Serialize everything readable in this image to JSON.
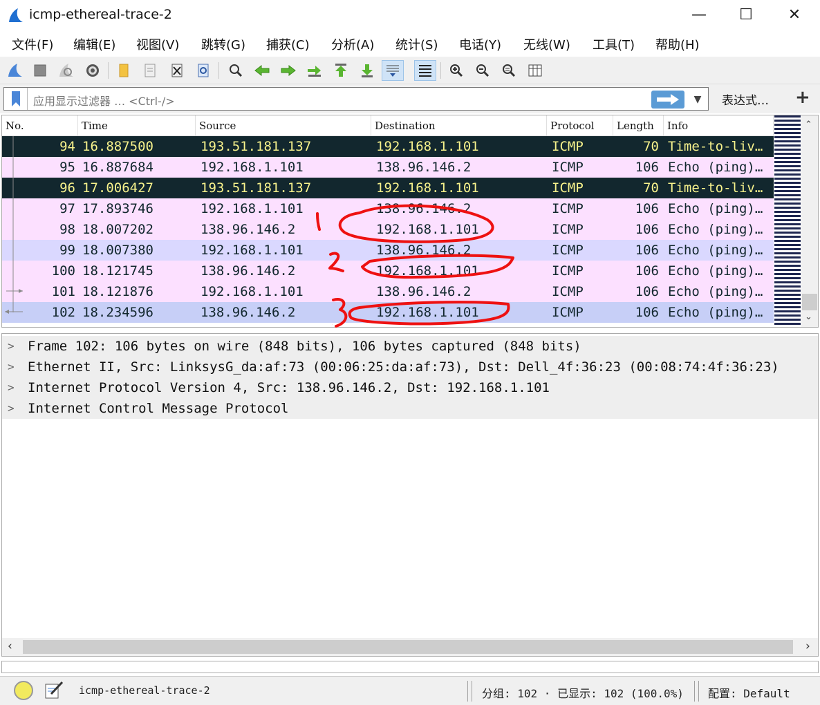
{
  "window": {
    "title": "icmp-ethereal-trace-2",
    "minimize": "—",
    "maximize": "☐",
    "close": "✕"
  },
  "menu": [
    "文件(F)",
    "编辑(E)",
    "视图(V)",
    "跳转(G)",
    "捕获(C)",
    "分析(A)",
    "统计(S)",
    "电话(Y)",
    "无线(W)",
    "工具(T)",
    "帮助(H)"
  ],
  "filter": {
    "placeholder": "应用显示过滤器 … <Ctrl-/>",
    "expression_label": "表达式…",
    "add_label": "+"
  },
  "packet_list": {
    "columns": [
      "No.",
      "Time",
      "Source",
      "Destination",
      "Protocol",
      "Length",
      "Info"
    ],
    "rows": [
      {
        "no": "94",
        "time": "16.887500",
        "source": "193.51.181.137",
        "destination": "192.168.1.101",
        "protocol": "ICMP",
        "length": "70",
        "info": "Time-to-liv…",
        "style": "dark"
      },
      {
        "no": "95",
        "time": "16.887684",
        "source": "192.168.1.101",
        "destination": "138.96.146.2",
        "protocol": "ICMP",
        "length": "106",
        "info": "Echo (ping)…",
        "style": "pink"
      },
      {
        "no": "96",
        "time": "17.006427",
        "source": "193.51.181.137",
        "destination": "192.168.1.101",
        "protocol": "ICMP",
        "length": "70",
        "info": "Time-to-liv…",
        "style": "dark"
      },
      {
        "no": "97",
        "time": "17.893746",
        "source": "192.168.1.101",
        "destination": "138.96.146.2",
        "protocol": "ICMP",
        "length": "106",
        "info": "Echo (ping)…",
        "style": "pink"
      },
      {
        "no": "98",
        "time": "18.007202",
        "source": "138.96.146.2",
        "destination": "192.168.1.101",
        "protocol": "ICMP",
        "length": "106",
        "info": "Echo (ping)…",
        "style": "pink"
      },
      {
        "no": "99",
        "time": "18.007380",
        "source": "192.168.1.101",
        "destination": "138.96.146.2",
        "protocol": "ICMP",
        "length": "106",
        "info": "Echo (ping)…",
        "style": "lav"
      },
      {
        "no": "100",
        "time": "18.121745",
        "source": "138.96.146.2",
        "destination": "192.168.1.101",
        "protocol": "ICMP",
        "length": "106",
        "info": "Echo (ping)…",
        "style": "pink"
      },
      {
        "no": "101",
        "time": "18.121876",
        "source": "192.168.1.101",
        "destination": "138.96.146.2",
        "protocol": "ICMP",
        "length": "106",
        "info": "Echo (ping)…",
        "style": "pink"
      },
      {
        "no": "102",
        "time": "18.234596",
        "source": "138.96.146.2",
        "destination": "192.168.1.101",
        "protocol": "ICMP",
        "length": "106",
        "info": "Echo (ping)…",
        "style": "sel"
      }
    ]
  },
  "details": [
    "Frame 102: 106 bytes on wire (848 bits), 106 bytes captured (848 bits)",
    "Ethernet II, Src: LinksysG_da:af:73 (00:06:25:da:af:73), Dst: Dell_4f:36:23 (00:08:74:4f:36:23)",
    "Internet Protocol Version 4, Src: 138.96.146.2, Dst: 192.168.1.101",
    "Internet Control Message Protocol"
  ],
  "status": {
    "file": "icmp-ethereal-trace-2",
    "stats": "分组: 102 · 已显示: 102 (100.0%)",
    "profile": "配置: Default"
  },
  "annotations": [
    "1",
    "2",
    "3"
  ],
  "colors": {
    "dark_row_bg": "#12272e",
    "dark_row_fg": "#f7f28c",
    "pink_row_bg": "#fce0ff",
    "lavender_row_bg": "#dad8ff",
    "selected_row_bg": "#c7cff7",
    "annotation_red": "#ee1111"
  }
}
